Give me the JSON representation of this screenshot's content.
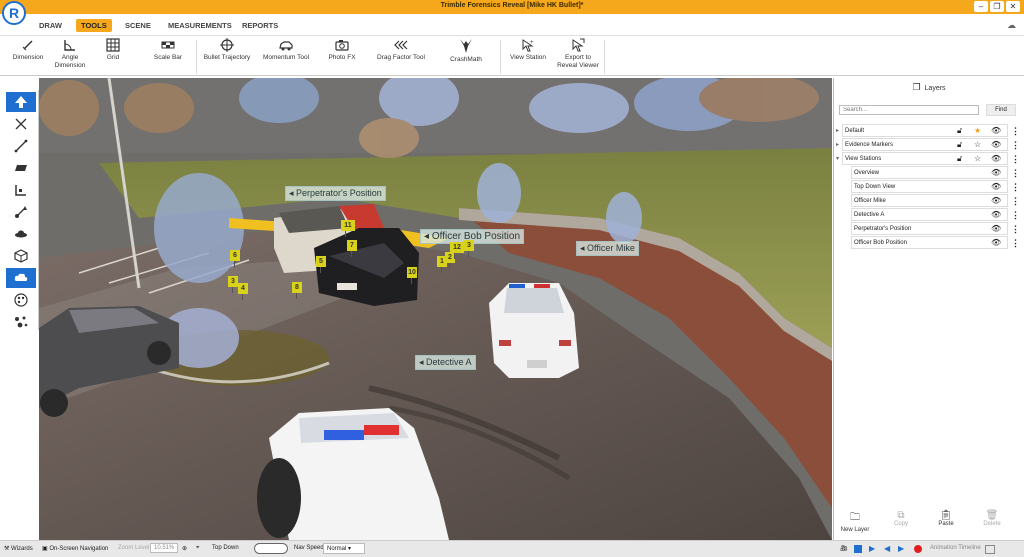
{
  "app": {
    "title": "Trimble Forensics Reveal [Mike HK Bullet]*"
  },
  "menu": [
    {
      "label": "DRAW"
    },
    {
      "label": "TOOLS",
      "active": true
    },
    {
      "label": "SCENE"
    },
    {
      "label": "MEASUREMENTS"
    },
    {
      "label": "REPORTS"
    }
  ],
  "toolbar": {
    "dimension": "Dimension",
    "angle_dimension": "Angle Dimension",
    "grid": "Grid",
    "scale_bar": "Scale Bar",
    "bullet_trajectory": "Bullet Trajectory",
    "momentum_tool": "Momentum Tool",
    "photo_fx": "Photo FX",
    "drag_factor_tool": "Drag Factor Tool",
    "crashmath": "CrashMath",
    "view_station": "View Station",
    "export_reveal_viewer": "Export to Reveal Viewer"
  },
  "left_tools": [
    "select-arrow-icon",
    "move-cross-icon",
    "line-icon",
    "surface-icon",
    "corner-icon",
    "vector-icon",
    "ufo-icon",
    "cube-icon",
    "cloud-icon",
    "palette-icon",
    "dots-icon"
  ],
  "scene": {
    "labels": {
      "perpetrator": "Perpetrator's Position",
      "officer_bob": "Officer Bob Position",
      "officer_mike": "Officer Mike",
      "detective": "Detective A"
    },
    "evidence": [
      "1",
      "2",
      "3",
      "4",
      "5",
      "6",
      "7",
      "8",
      "10",
      "11",
      "12",
      "3"
    ]
  },
  "layers": {
    "title": "Layers",
    "search_placeholder": "Search...",
    "find": "Find",
    "rows": [
      {
        "label": "Default",
        "expand": "▸",
        "star": "★",
        "star_color": "#f0a020"
      },
      {
        "label": "Evidence Markers",
        "expand": "▸",
        "star": "☆",
        "star_color": "#333"
      },
      {
        "label": "View Stations",
        "expand": "▾",
        "star": "☆",
        "star_color": "#333"
      }
    ],
    "stations": [
      "Overview",
      "Top Down View",
      "Officer Mike",
      "Detective A",
      "Perpetrator's Position",
      "Officer Bob Position"
    ],
    "actions": {
      "new_layer": "New Layer",
      "copy": "Copy",
      "paste": "Paste",
      "delete": "Delete"
    }
  },
  "status": {
    "wizards": "Wizards",
    "onscreen_nav": "On-Screen Navigation",
    "zoom_label": "Zoom Level",
    "zoom_value": "10.51%",
    "top_down": "Top Down",
    "nav_speed_label": "Nav Speed",
    "nav_speed_value": "Normal",
    "animation_timeline": "Animation Timeline"
  },
  "colors": {
    "accent": "#f5a81c",
    "select": "#1e6fd0",
    "record": "#e02020",
    "play": "#1e6fd0"
  }
}
